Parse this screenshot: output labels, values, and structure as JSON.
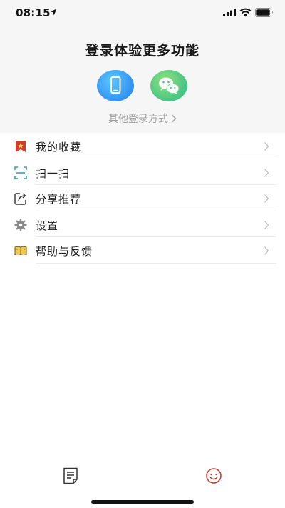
{
  "status_bar": {
    "time": "08:15"
  },
  "login": {
    "title": "登录体验更多功能",
    "other_methods": "其他登录方式",
    "phone_icon": "phone-icon",
    "wechat_icon": "wechat-icon"
  },
  "menu": {
    "items": [
      {
        "label": "我的收藏",
        "icon": "bookmark-icon"
      },
      {
        "label": "扫一扫",
        "icon": "scan-icon"
      },
      {
        "label": "分享推荐",
        "icon": "share-icon"
      },
      {
        "label": "设置",
        "icon": "gear-icon"
      },
      {
        "label": "帮助与反馈",
        "icon": "book-icon"
      }
    ]
  },
  "tabs": {
    "items": [
      {
        "icon": "notes-icon"
      },
      {
        "icon": "smiley-icon"
      }
    ]
  },
  "colors": {
    "header_bg": "#f6f6f6",
    "phone_button": "#2f8ff0",
    "wechat_button": "#3fbf87",
    "muted_text": "#a0a0a0",
    "active_tab": "#c0392b"
  }
}
